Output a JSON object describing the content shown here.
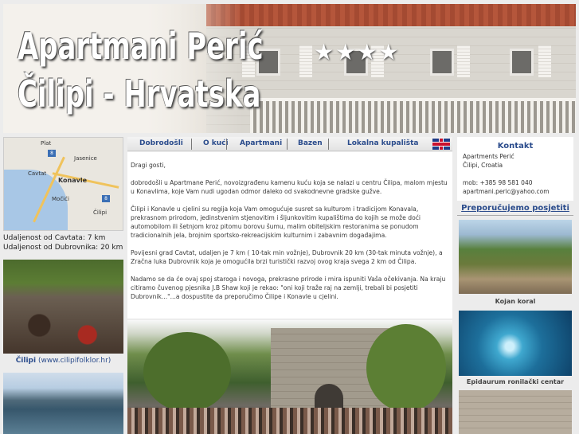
{
  "header": {
    "title_line1": "Apartmani Perić",
    "title_line2": "Čilipi - Hrvatska",
    "stars": "★★★★"
  },
  "nav": {
    "items": [
      "Dobrodošli",
      "O kući",
      "Apartmani",
      "Bazen",
      "Lokalna kupališta"
    ],
    "language_flag": "uk-flag-icon"
  },
  "map": {
    "labels": [
      "Plat",
      "Jasenice",
      "Cavtat",
      "Konavle",
      "Močići",
      "Čilipi"
    ],
    "road_badges": [
      "8",
      "8"
    ]
  },
  "distances": {
    "cavtat": "Udaljenost od Cavtata: 7 km",
    "dubrovnik": "Udaljenost od Dubrovnika: 20 km"
  },
  "folklore": {
    "caption_bold": "Čilipi",
    "caption_link": "(www.cilipifolklor.hr)"
  },
  "main": {
    "greeting": "Dragi gosti,",
    "p1": "dobrodošli u Apartmane Perić, novoizgrađenu kamenu kuću koja se nalazi u centru Čilipa, malom mjestu u Konavlima, koje Vam nudi ugodan odmor daleko od svakodnevne gradske gužve.",
    "p2": "Čilipi i Konavle u cjelini su regija koja Vam omogućuje susret sa kulturom i tradicijom Konavala, prekrasnom prirodom, jedinstvenim stjenovitim i šljunkovitim kupalištima do kojih se može doći automobilom ili šetnjom kroz pitomu borovu šumu, malim obiteljskim restoranima se ponudom tradicionalnih jela, brojnim sportsko-rekreacijskim kulturnim i zabavnim događajima.",
    "p3": "Povijesni grad Cavtat, udaljen je 7 km ( 10-tak min vožnje), Dubrovnik 20 km (30-tak minuta vožnje), a Zračna luka Dubrovnik koja je omogućila brzi turistički razvoj ovog kraja svega 2 km od Čilipa.",
    "p4": "Nadamo se da će ovaj spoj staroga i novoga, prekrasne prirode i mira ispuniti Vaša očekivanja. Na kraju citiramo čuvenog pjesnika J.B Shaw koji je rekao: \"oni koji traže raj na zemlji, trebali bi posjetiti Dubrovnik...\"...a dospustite da preporučimo Čilipe i Konavle u cjelini."
  },
  "contact": {
    "title": "Kontakt",
    "name": "Apartments Perić",
    "location": "Čilipi, Croatia",
    "phone": "mob: +385 98 581 040",
    "email": "apartmani.peric@yahoo.com"
  },
  "recommend": {
    "title": "Preporučujemo posjetiti",
    "items": [
      {
        "caption": "Kojan koral"
      },
      {
        "caption": "Epidaurum ronilački centar"
      }
    ]
  }
}
